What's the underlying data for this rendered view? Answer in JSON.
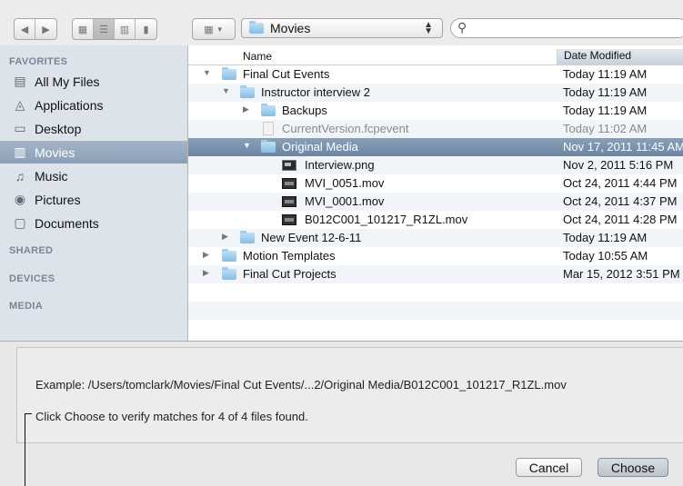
{
  "toolbar": {
    "path_label": "Movies",
    "search_placeholder": ""
  },
  "sidebar": {
    "sections": [
      "FAVORITES",
      "SHARED",
      "DEVICES",
      "MEDIA"
    ],
    "items": [
      {
        "label": "All My Files",
        "icon": "all-files-icon"
      },
      {
        "label": "Applications",
        "icon": "applications-icon"
      },
      {
        "label": "Desktop",
        "icon": "desktop-icon"
      },
      {
        "label": "Movies",
        "icon": "movies-icon",
        "selected": true
      },
      {
        "label": "Music",
        "icon": "music-icon"
      },
      {
        "label": "Pictures",
        "icon": "camera-icon"
      },
      {
        "label": "Documents",
        "icon": "documents-icon"
      }
    ]
  },
  "filelist": {
    "columns": {
      "name": "Name",
      "date": "Date Modified"
    },
    "rows": [
      {
        "name": "Final Cut Events",
        "date": "Today 11:19 AM"
      },
      {
        "name": "Instructor interview 2",
        "date": "Today 11:19 AM"
      },
      {
        "name": "Backups",
        "date": "Today 11:19 AM"
      },
      {
        "name": "CurrentVersion.fcpevent",
        "date": "Today 11:02 AM"
      },
      {
        "name": "Original Media",
        "date": "Nov 17, 2011 11:45 AM"
      },
      {
        "name": "Interview.png",
        "date": "Nov 2, 2011 5:16 PM"
      },
      {
        "name": "MVI_0051.mov",
        "date": "Oct 24, 2011 4:44 PM"
      },
      {
        "name": "MVI_0001.mov",
        "date": "Oct 24, 2011 4:37 PM"
      },
      {
        "name": "B012C001_101217_R1ZL.mov",
        "date": "Oct 24, 2011 4:28 PM"
      },
      {
        "name": "New Event 12-6-11",
        "date": "Today 11:19 AM"
      },
      {
        "name": "Motion Templates",
        "date": "Today 10:55 AM"
      },
      {
        "name": "Final Cut Projects",
        "date": "Mar 15, 2012 3:51 PM"
      }
    ]
  },
  "panel": {
    "example": "Example: /Users/tomclark/Movies/Final Cut Events/...2/Original Media/B012C001_101217_R1ZL.mov",
    "verify": "Click Choose to verify matches for 4 of 4 files found.",
    "cancel_label": "Cancel",
    "choose_label": "Choose"
  }
}
